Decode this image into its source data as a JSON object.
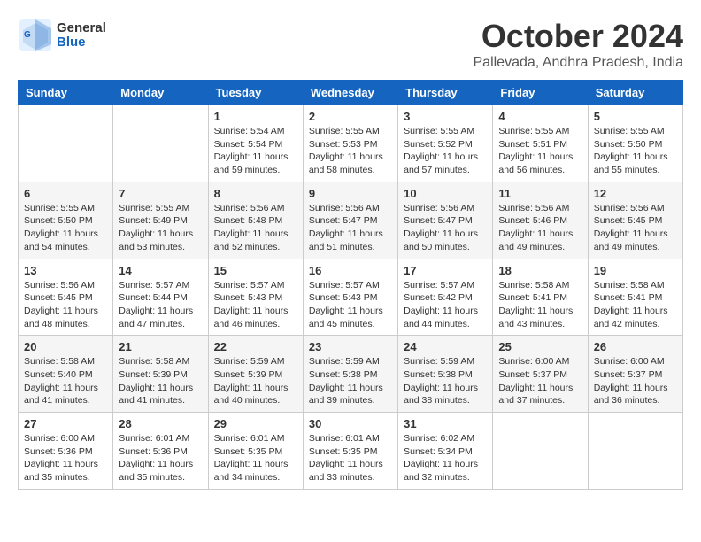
{
  "header": {
    "logo_general": "General",
    "logo_blue": "Blue",
    "title": "October 2024",
    "location": "Pallevada, Andhra Pradesh, India"
  },
  "columns": [
    "Sunday",
    "Monday",
    "Tuesday",
    "Wednesday",
    "Thursday",
    "Friday",
    "Saturday"
  ],
  "weeks": [
    [
      {
        "day": "",
        "info": ""
      },
      {
        "day": "",
        "info": ""
      },
      {
        "day": "1",
        "info": "Sunrise: 5:54 AM\nSunset: 5:54 PM\nDaylight: 11 hours and 59 minutes."
      },
      {
        "day": "2",
        "info": "Sunrise: 5:55 AM\nSunset: 5:53 PM\nDaylight: 11 hours and 58 minutes."
      },
      {
        "day": "3",
        "info": "Sunrise: 5:55 AM\nSunset: 5:52 PM\nDaylight: 11 hours and 57 minutes."
      },
      {
        "day": "4",
        "info": "Sunrise: 5:55 AM\nSunset: 5:51 PM\nDaylight: 11 hours and 56 minutes."
      },
      {
        "day": "5",
        "info": "Sunrise: 5:55 AM\nSunset: 5:50 PM\nDaylight: 11 hours and 55 minutes."
      }
    ],
    [
      {
        "day": "6",
        "info": "Sunrise: 5:55 AM\nSunset: 5:50 PM\nDaylight: 11 hours and 54 minutes."
      },
      {
        "day": "7",
        "info": "Sunrise: 5:55 AM\nSunset: 5:49 PM\nDaylight: 11 hours and 53 minutes."
      },
      {
        "day": "8",
        "info": "Sunrise: 5:56 AM\nSunset: 5:48 PM\nDaylight: 11 hours and 52 minutes."
      },
      {
        "day": "9",
        "info": "Sunrise: 5:56 AM\nSunset: 5:47 PM\nDaylight: 11 hours and 51 minutes."
      },
      {
        "day": "10",
        "info": "Sunrise: 5:56 AM\nSunset: 5:47 PM\nDaylight: 11 hours and 50 minutes."
      },
      {
        "day": "11",
        "info": "Sunrise: 5:56 AM\nSunset: 5:46 PM\nDaylight: 11 hours and 49 minutes."
      },
      {
        "day": "12",
        "info": "Sunrise: 5:56 AM\nSunset: 5:45 PM\nDaylight: 11 hours and 49 minutes."
      }
    ],
    [
      {
        "day": "13",
        "info": "Sunrise: 5:56 AM\nSunset: 5:45 PM\nDaylight: 11 hours and 48 minutes."
      },
      {
        "day": "14",
        "info": "Sunrise: 5:57 AM\nSunset: 5:44 PM\nDaylight: 11 hours and 47 minutes."
      },
      {
        "day": "15",
        "info": "Sunrise: 5:57 AM\nSunset: 5:43 PM\nDaylight: 11 hours and 46 minutes."
      },
      {
        "day": "16",
        "info": "Sunrise: 5:57 AM\nSunset: 5:43 PM\nDaylight: 11 hours and 45 minutes."
      },
      {
        "day": "17",
        "info": "Sunrise: 5:57 AM\nSunset: 5:42 PM\nDaylight: 11 hours and 44 minutes."
      },
      {
        "day": "18",
        "info": "Sunrise: 5:58 AM\nSunset: 5:41 PM\nDaylight: 11 hours and 43 minutes."
      },
      {
        "day": "19",
        "info": "Sunrise: 5:58 AM\nSunset: 5:41 PM\nDaylight: 11 hours and 42 minutes."
      }
    ],
    [
      {
        "day": "20",
        "info": "Sunrise: 5:58 AM\nSunset: 5:40 PM\nDaylight: 11 hours and 41 minutes."
      },
      {
        "day": "21",
        "info": "Sunrise: 5:58 AM\nSunset: 5:39 PM\nDaylight: 11 hours and 41 minutes."
      },
      {
        "day": "22",
        "info": "Sunrise: 5:59 AM\nSunset: 5:39 PM\nDaylight: 11 hours and 40 minutes."
      },
      {
        "day": "23",
        "info": "Sunrise: 5:59 AM\nSunset: 5:38 PM\nDaylight: 11 hours and 39 minutes."
      },
      {
        "day": "24",
        "info": "Sunrise: 5:59 AM\nSunset: 5:38 PM\nDaylight: 11 hours and 38 minutes."
      },
      {
        "day": "25",
        "info": "Sunrise: 6:00 AM\nSunset: 5:37 PM\nDaylight: 11 hours and 37 minutes."
      },
      {
        "day": "26",
        "info": "Sunrise: 6:00 AM\nSunset: 5:37 PM\nDaylight: 11 hours and 36 minutes."
      }
    ],
    [
      {
        "day": "27",
        "info": "Sunrise: 6:00 AM\nSunset: 5:36 PM\nDaylight: 11 hours and 35 minutes."
      },
      {
        "day": "28",
        "info": "Sunrise: 6:01 AM\nSunset: 5:36 PM\nDaylight: 11 hours and 35 minutes."
      },
      {
        "day": "29",
        "info": "Sunrise: 6:01 AM\nSunset: 5:35 PM\nDaylight: 11 hours and 34 minutes."
      },
      {
        "day": "30",
        "info": "Sunrise: 6:01 AM\nSunset: 5:35 PM\nDaylight: 11 hours and 33 minutes."
      },
      {
        "day": "31",
        "info": "Sunrise: 6:02 AM\nSunset: 5:34 PM\nDaylight: 11 hours and 32 minutes."
      },
      {
        "day": "",
        "info": ""
      },
      {
        "day": "",
        "info": ""
      }
    ]
  ]
}
